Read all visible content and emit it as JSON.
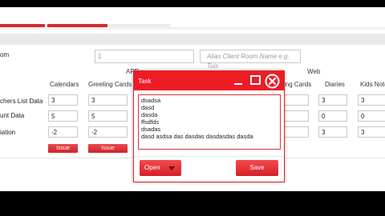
{
  "form": {
    "room_label": "om",
    "room_value": "1",
    "alias_placeholder": "Alias Client Room Name e.g. Tuis"
  },
  "columns": {
    "app_group": "APP",
    "web_group": "Web",
    "calendars": "Calendars",
    "greeting_cards_left": "Greeting Cards",
    "greeting_cards_right": "ing Cards",
    "diaries": "Diaries",
    "kids_notes": "Kids Note"
  },
  "rows": [
    {
      "label": "chers List Data",
      "calendars": "3",
      "greeting": "3",
      "web_greeting": "",
      "diaries": "3",
      "kids": "3"
    },
    {
      "label": "unt Data",
      "calendars": "5",
      "greeting": "5",
      "web_greeting": "",
      "diaries": "0",
      "kids": "0"
    },
    {
      "label": "iation",
      "calendars": "-2",
      "greeting": "-2",
      "web_greeting": "",
      "diaries": "3",
      "kids": "3"
    }
  ],
  "issue_label": "Issue",
  "dialog": {
    "title": "Task",
    "text_lines": [
      "dsadsa",
      "dasd",
      "dasda",
      "ffsdfds",
      "dsadas",
      "dasd asdsa das dasdas dasdasdas dasda"
    ],
    "open_label": "Open",
    "save_label": "Save"
  },
  "colors": {
    "accent": "#ee1c25",
    "issue": "#d9282f"
  }
}
